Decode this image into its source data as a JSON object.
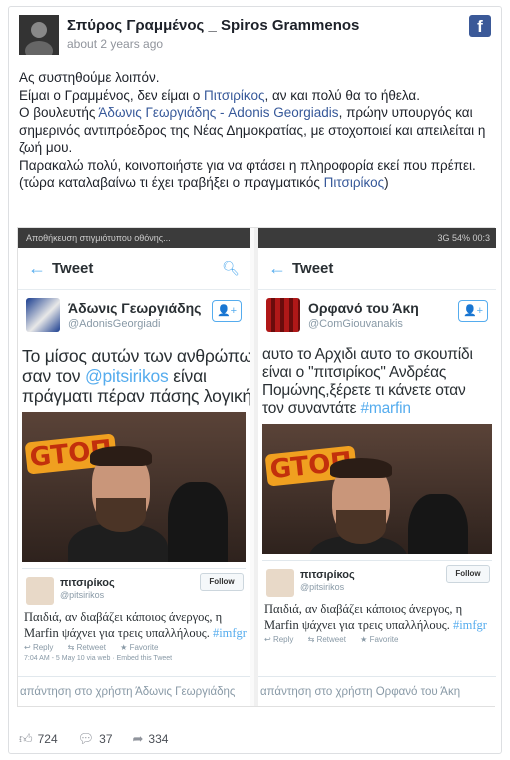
{
  "post": {
    "author": "Σπύρος Γραμμένος _ Spiros Grammenos",
    "time": "about 2 years ago",
    "facebook_icon": "f",
    "paragraphs": [
      {
        "parts": [
          {
            "t": "Ας συστηθούμε λοιπόν."
          }
        ]
      },
      {
        "parts": [
          {
            "t": "Είμαι ο Γραμμένος, δεν είμαι ο "
          },
          {
            "t": "Πιτσιρίκος",
            "link": true
          },
          {
            "t": ", αν και πολύ θα το ήθελα."
          }
        ]
      },
      {
        "parts": [
          {
            "t": "Ο βουλευτής "
          },
          {
            "t": "Άδωνις Γεωργιάδης - Adonis Georgiadis",
            "link": true
          },
          {
            "t": ", πρώην υπουργός και σημερινός αντιπρόεδρος της Νέας Δημοκρατίας, με στοχοποιεί και απειλείται η ζωή μου."
          }
        ]
      },
      {
        "parts": [
          {
            "t": "Παρακαλώ πολύ, κοινοποιήστε για να φτάσει η πληροφορία εκεί που πρέπει."
          }
        ]
      },
      {
        "parts": [
          {
            "t": "(τώρα καταλαβαίνω τι έχει τραβήξει ο πραγματικός "
          },
          {
            "t": "Πιτσιρίκος",
            "link": true
          },
          {
            "t": ")"
          }
        ]
      }
    ]
  },
  "left_phone": {
    "status_text": "Αποθήκευση στιγμιότυπου οθόνης...",
    "appbar_title": "Tweet",
    "name": "Άδωνις Γεωργιάδης",
    "handle": "@AdonisGeorgiadi",
    "tweet_lines": [
      [
        {
          "t": "Το μίσος αυτών των ανθρώπων"
        }
      ],
      [
        {
          "t": "σαν τον "
        },
        {
          "t": "@pitsirikos",
          "hl": true
        },
        {
          "t": " είναι"
        }
      ],
      [
        {
          "t": "πράγματι πέραν πάσης λογικής..."
        }
      ]
    ],
    "reply": "απάντηση στο χρήστη Άδωνις Γεωργιάδης"
  },
  "right_phone": {
    "status_text": "3G 54% 00:3",
    "appbar_title": "Tweet",
    "name": "Ορφανό του Άκη",
    "handle": "@ComGiouvanakis",
    "tweet_lines": [
      [
        {
          "t": "αυτο το Αρχιδι αυτο το σκουπίδι"
        }
      ],
      [
        {
          "t": "είναι ο \"πιτσιρίκος\" Ανδρέας"
        }
      ],
      [
        {
          "t": "Πομώνης,ξέρετε τι κάνετε οταν"
        }
      ],
      [
        {
          "t": "τον συναντάτε "
        },
        {
          "t": "#marfin",
          "hl": true
        }
      ]
    ],
    "reply": "απάντηση στο χρήστη Ορφανό του Άκη"
  },
  "embed": {
    "sign_text": "GTOΠ",
    "name": "πιτσιρίκος",
    "handle": "@pitsirikos",
    "follow": "Follow",
    "text_parts": [
      {
        "t": "Παιδιά, αν διαβάζει κάποιος άνεργος, η Marfin ψάχνει για τρεις υπαλλήλους. "
      },
      {
        "t": "#imfgr",
        "hl": true
      }
    ],
    "reply": "Reply",
    "retweet": "Retweet",
    "favorite": "Favorite",
    "date": "7:04 AM - 5 May 10 via web · Embed this Tweet"
  },
  "footer": {
    "likes": "724",
    "comments": "37",
    "shares": "334"
  },
  "colors": {
    "link": "#365899",
    "twitter": "#55acee",
    "facebook": "#3b5998"
  }
}
